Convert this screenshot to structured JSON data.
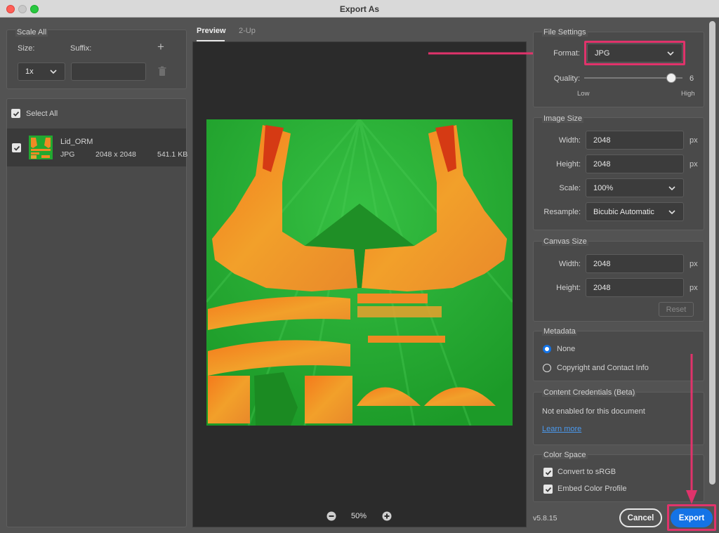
{
  "window": {
    "title": "Export As"
  },
  "left": {
    "scale_all": {
      "title": "Scale All",
      "size_label": "Size:",
      "suffix_label": "Suffix:",
      "size_value": "1x",
      "suffix_value": ""
    },
    "select_all_label": "Select All",
    "assets": [
      {
        "name": "Lid_ORM",
        "format": "JPG",
        "dimensions": "2048 x 2048",
        "size": "541.1 KB",
        "checked": true
      }
    ]
  },
  "preview": {
    "tabs": [
      {
        "label": "Preview",
        "active": true
      },
      {
        "label": "2-Up",
        "active": false
      }
    ],
    "zoom": "50%"
  },
  "file_settings": {
    "title": "File Settings",
    "format_label": "Format:",
    "format_value": "JPG",
    "quality_label": "Quality:",
    "quality_value": "6",
    "quality_fraction": 0.95,
    "low_label": "Low",
    "high_label": "High"
  },
  "image_size": {
    "title": "Image Size",
    "width_label": "Width:",
    "width_value": "2048",
    "height_label": "Height:",
    "height_value": "2048",
    "scale_label": "Scale:",
    "scale_value": "100%",
    "resample_label": "Resample:",
    "resample_value": "Bicubic Automatic",
    "unit": "px"
  },
  "canvas_size": {
    "title": "Canvas Size",
    "width_label": "Width:",
    "width_value": "2048",
    "height_label": "Height:",
    "height_value": "2048",
    "unit": "px",
    "reset_label": "Reset"
  },
  "metadata": {
    "title": "Metadata",
    "options": [
      {
        "label": "None",
        "selected": true
      },
      {
        "label": "Copyright and Contact Info",
        "selected": false
      }
    ]
  },
  "content_credentials": {
    "title": "Content Credentials (Beta)",
    "status": "Not enabled for this document",
    "link": "Learn more"
  },
  "color_space": {
    "title": "Color Space",
    "convert_label": "Convert to sRGB",
    "convert_checked": true,
    "embed_label": "Embed Color Profile",
    "embed_checked": true
  },
  "footer": {
    "version": "v5.8.15",
    "cancel_label": "Cancel",
    "export_label": "Export"
  },
  "colors": {
    "accent": "#1473e6",
    "annotation": "#e0336b",
    "texture_green": "#22a830",
    "texture_orange": "#f08a24"
  }
}
